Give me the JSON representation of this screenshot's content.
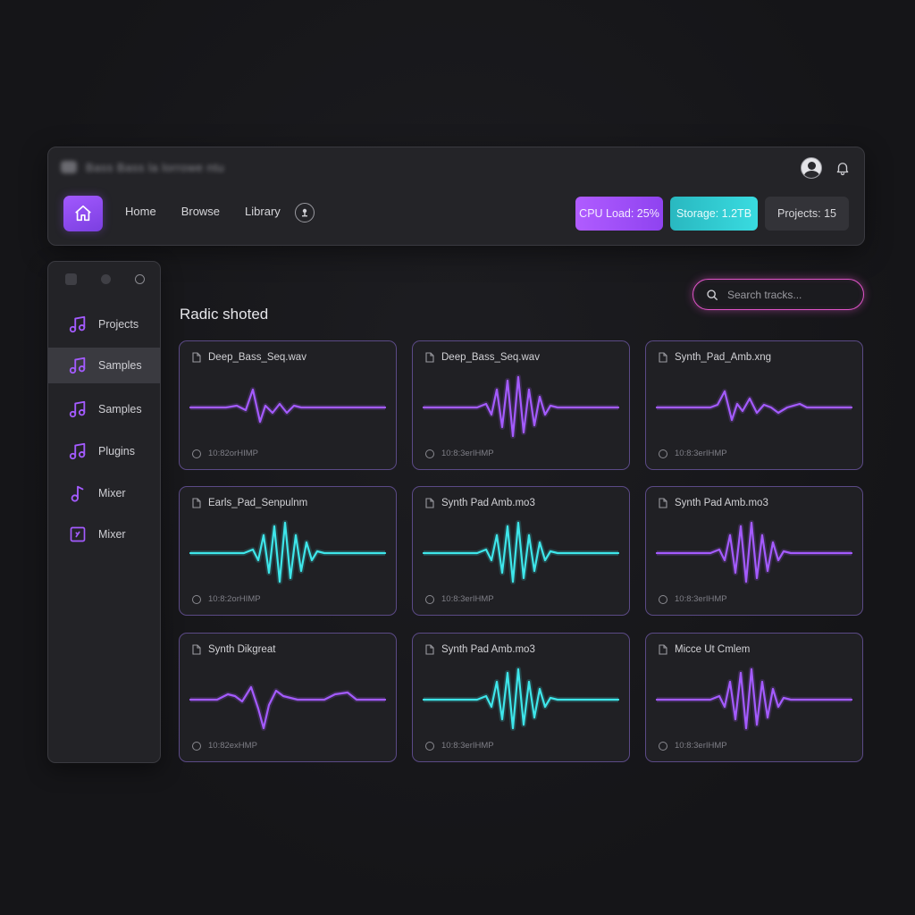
{
  "topbar": {
    "blurred_title": "Bass Bass la lorrowe ntu",
    "nav": [
      "Home",
      "Browse",
      "Library"
    ],
    "stats": {
      "cpu": "CPU Load: 25%",
      "storage": "Storage: 1.2TB",
      "projects": "Projects: 15"
    }
  },
  "sidebar": {
    "items": [
      {
        "label": "Projects",
        "icon": "music-note-icon"
      },
      {
        "label": "Samples",
        "icon": "music-note-icon",
        "active": true
      },
      {
        "label": "Samples",
        "icon": "music-note-icon"
      },
      {
        "label": "Plugins",
        "icon": "music-note-icon"
      },
      {
        "label": "Mixer",
        "icon": "single-note-icon"
      },
      {
        "label": "Mixer",
        "icon": "mixer-box-icon"
      }
    ]
  },
  "main": {
    "section_title": "Radic shoted",
    "search_placeholder": "Search tracks..."
  },
  "colors": {
    "purple": "#a45bff",
    "cyan": "#3ee6ea",
    "search_accent": "#e054c8"
  },
  "cards": [
    {
      "name": "Deep_Bass_Seq.wav",
      "meta": "10:82orHIMP",
      "color": "purple",
      "shape": "small"
    },
    {
      "name": "Deep_Bass_Seq.wav",
      "meta": "10:8:3erIHMP",
      "color": "purple",
      "shape": "big"
    },
    {
      "name": "Synth_Pad_Amb.xng",
      "meta": "10:8:3erIHMP",
      "color": "purple",
      "shape": "multi"
    },
    {
      "name": "Earls_Pad_Senpulnm",
      "meta": "10:8:2orHIMP",
      "color": "cyan",
      "shape": "big"
    },
    {
      "name": "Synth Pad Amb.mo3",
      "meta": "10:8:3erIHMP",
      "color": "cyan",
      "shape": "big"
    },
    {
      "name": "Synth Pad Amb.mo3",
      "meta": "10:8:3erIHMP",
      "color": "purple",
      "shape": "big"
    },
    {
      "name": "Synth Dikgreat",
      "meta": "10:82exHMP",
      "color": "purple",
      "shape": "dip"
    },
    {
      "name": "Synth Pad Amb.mo3",
      "meta": "10:8:3erIHMP",
      "color": "cyan",
      "shape": "big"
    },
    {
      "name": "Micce Ut Cmlem",
      "meta": "10:8:3erIHMP",
      "color": "purple",
      "shape": "big"
    }
  ]
}
